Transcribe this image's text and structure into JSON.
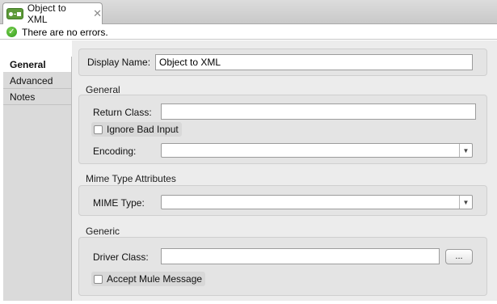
{
  "editor": {
    "tab_title": "Object to XML",
    "tab_icon": "transformer-icon",
    "close_glyph": "✕"
  },
  "status": {
    "icon": "ok-check-icon",
    "message": "There are no errors."
  },
  "sidebar": {
    "tabs": [
      {
        "label": "General",
        "active": true
      },
      {
        "label": "Advanced",
        "active": false
      },
      {
        "label": "Notes",
        "active": false
      }
    ]
  },
  "general": {
    "display_name_label": "Display Name:",
    "display_name_value": "Object to XML",
    "section_title": "General",
    "return_class_label": "Return Class:",
    "return_class_value": "",
    "ignore_bad_input_label": "Ignore Bad Input",
    "ignore_bad_input_checked": false,
    "encoding_label": "Encoding:",
    "encoding_value": ""
  },
  "mime": {
    "section_title": "Mime Type Attributes",
    "mime_type_label": "MIME Type:",
    "mime_type_value": ""
  },
  "generic": {
    "section_title": "Generic",
    "driver_class_label": "Driver Class:",
    "driver_class_value": "",
    "browse_label": "...",
    "accept_mule_label": "Accept Mule Message",
    "accept_mule_checked": false
  },
  "colors": {
    "icon_green": "#5e9a3a",
    "ok_green": "#2f9a1b",
    "panel_bg": "#ececec",
    "sidebar_bg": "#dadada"
  }
}
